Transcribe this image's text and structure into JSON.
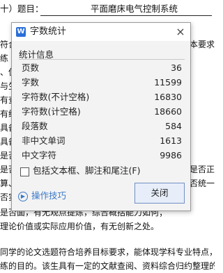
{
  "document": {
    "title_prefix": "十）题目：",
    "title_text": "平面磨床电气控制系统",
    "left_fragments": [
      "符合",
      "练",
      "、伪",
      "与生",
      "有查",
      "有统",
      "具备",
      "具备",
      "是否",
      "是否",
      "算、",
      "否实"
    ],
    "right_fragments": [
      "本要求",
      "",
      "",
      "",
      "",
      "",
      "",
      "",
      "",
      "是否正",
      "否统一",
      ""
    ],
    "line_bottom_1": "是否面，有无观点提炼，综合概括能力如何；",
    "line_bottom_2": "理论价值或实际应用价值，有无创新之处。",
    "line_bottom_3": "同学的论文选题符合培养目标要求，能体现学科专业特点，",
    "line_bottom_4": "练的目的。该生具有一定的文献查阅、资料综合归约整理的"
  },
  "dialog": {
    "title": "字数统计",
    "app_icon_text": "W",
    "close_symbol": "×",
    "group_title": "统计信息",
    "stats": [
      {
        "label": "页数",
        "value": "36"
      },
      {
        "label": "字数",
        "value": "11599"
      },
      {
        "label": "字符数(不计空格)",
        "value": "16830"
      },
      {
        "label": "字符数(计空格)",
        "value": "18660"
      },
      {
        "label": "段落数",
        "value": "584"
      },
      {
        "label": "非中文单词",
        "value": "1613"
      },
      {
        "label": "中文字符",
        "value": "9986"
      }
    ],
    "checkbox_label": "包括文本框、脚注和尾注(F)",
    "checkbox_checked": false,
    "tips_label": "操作技巧",
    "close_button_label": "关闭"
  }
}
